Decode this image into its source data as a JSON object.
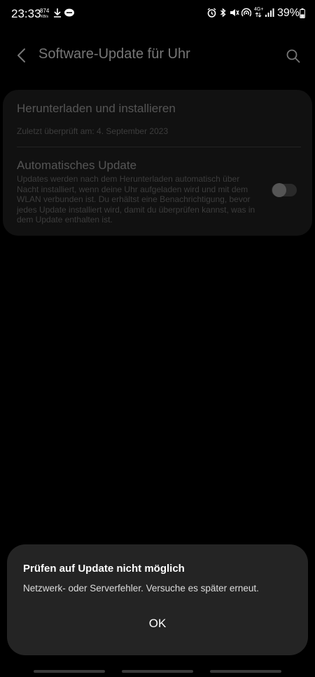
{
  "status_bar": {
    "time": "23:33",
    "net_rate": "874",
    "net_rate_unit": "KB/s",
    "battery": "39%",
    "network": "4G+"
  },
  "header": {
    "title": "Software-Update für Uhr"
  },
  "settings": {
    "download": {
      "title": "Herunterladen und installieren",
      "last_checked": "Zuletzt überprüft am: 4. September 2023"
    },
    "auto_update": {
      "title": "Automatisches Update",
      "description": "Updates werden nach dem Herunterladen automatisch über Nacht installiert, wenn deine Uhr aufgeladen wird und mit dem WLAN verbunden ist. Du erhältst eine Benachrichtigung, bevor jedes Update installiert wird, damit du überprüfen kannst, was in dem Update enthalten ist.",
      "enabled": false
    }
  },
  "dialog": {
    "title": "Prüfen auf Update nicht möglich",
    "message": "Netzwerk- oder Serverfehler. Versuche es später erneut.",
    "ok_label": "OK"
  },
  "colors": {
    "background": "#000000",
    "card": "#111111",
    "dialog": "#242424",
    "text_dim": "#555555"
  }
}
